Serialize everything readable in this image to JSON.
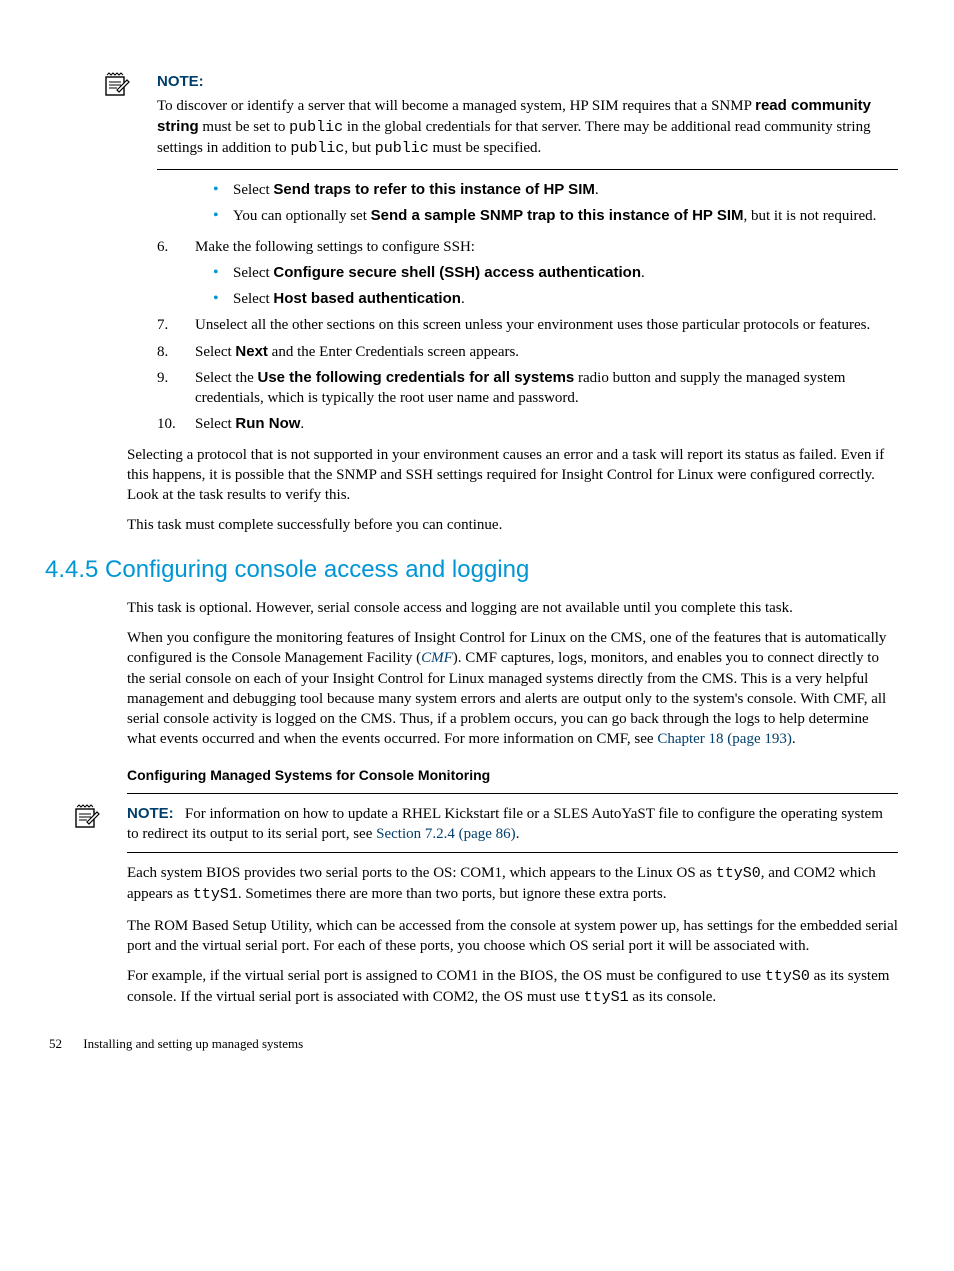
{
  "note1": {
    "label": "NOTE:",
    "body_1a": "To discover or identify a server that will become a managed system, HP SIM requires that a SNMP ",
    "body_1b": "read community string",
    "body_1c": " must be set to ",
    "body_1d": "public",
    "body_1e": " in the global credentials for that server. There may be additional read community string settings in addition to ",
    "body_1f": "public",
    "body_1g": ", but ",
    "body_1h": "public",
    "body_1i": " must be specified."
  },
  "bullets_top": {
    "b1_a": "Select ",
    "b1_b": "Send traps to refer to this instance of HP SIM",
    "b1_c": ".",
    "b2_a": "You can optionally set ",
    "b2_b": "Send a sample SNMP trap to this instance of HP SIM",
    "b2_c": ", but it is not required."
  },
  "steps": {
    "s6": {
      "num": "6.",
      "text": "Make the following settings to configure SSH:",
      "sb1_a": "Select ",
      "sb1_b": "Configure secure shell (SSH) access authentication",
      "sb1_c": ".",
      "sb2_a": "Select ",
      "sb2_b": "Host based authentication",
      "sb2_c": "."
    },
    "s7": {
      "num": "7.",
      "text": "Unselect all the other sections on this screen unless your environment uses those particular protocols or features."
    },
    "s8": {
      "num": "8.",
      "a": "Select ",
      "b": "Next",
      "c": " and the Enter Credentials screen appears."
    },
    "s9": {
      "num": "9.",
      "a": "Select the ",
      "b": "Use the following credentials for all systems",
      "c": " radio button and supply the managed system credentials, which is typically the root user name and password."
    },
    "s10": {
      "num": "10.",
      "a": "Select ",
      "b": "Run Now",
      "c": "."
    }
  },
  "para1": "Selecting a protocol that is not supported in your environment causes an error and a task will report its status as failed. Even if this happens, it is possible that the SNMP and SSH settings required for Insight Control for Linux were configured correctly. Look at the task results to verify this.",
  "para2": "This task must complete successfully before you can continue.",
  "section_title": "4.4.5 Configuring console access and logging",
  "para3": "This task is optional. However, serial console access and logging are not available until you complete this task.",
  "para4": {
    "a": "When you configure the monitoring features of Insight Control for Linux on the CMS, one of the features that is automatically configured is the Console Management Facility (",
    "b": "CMF",
    "c": "). CMF captures, logs, monitors, and enables you to connect directly to the serial console on each of your Insight Control for Linux managed systems directly from the CMS. This is a very helpful management and debugging tool because many system errors and alerts are output only to the system's console. With CMF, all serial console activity is logged on the CMS. Thus, if a problem occurs, you can go back through the logs to help determine what events occurred and when the events occurred. For more information on CMF, see ",
    "d": "Chapter 18 (page 193)",
    "e": "."
  },
  "sub_heading": "Configuring Managed Systems for Console Monitoring",
  "note2": {
    "label": "NOTE:",
    "a": "For information on how to update a RHEL Kickstart file or a SLES AutoYaST file to configure the operating system to redirect its output to its serial port, see ",
    "b": "Section 7.2.4 (page 86)",
    "c": "."
  },
  "para5": {
    "a": "Each system BIOS provides two serial ports to the OS: COM1, which appears to the Linux OS as ",
    "b": "ttyS0",
    "c": ", and COM2 which appears as ",
    "d": "ttyS1",
    "e": ". Sometimes there are more than two ports, but ignore these extra ports."
  },
  "para6": "The ROM Based Setup Utility, which can be accessed from the console at system power up, has settings for the embedded serial port and the virtual serial port. For each of these ports, you choose which OS serial port it will be associated with.",
  "para7": {
    "a": "For example, if the virtual serial port is assigned to COM1 in the BIOS, the OS must be configured to use ",
    "b": "ttyS0",
    "c": " as its system console. If the virtual serial port is associated with COM2, the OS must use ",
    "d": "ttyS1",
    "e": " as its console."
  },
  "footer": {
    "page": "52",
    "chapter": "Installing and setting up managed systems"
  }
}
